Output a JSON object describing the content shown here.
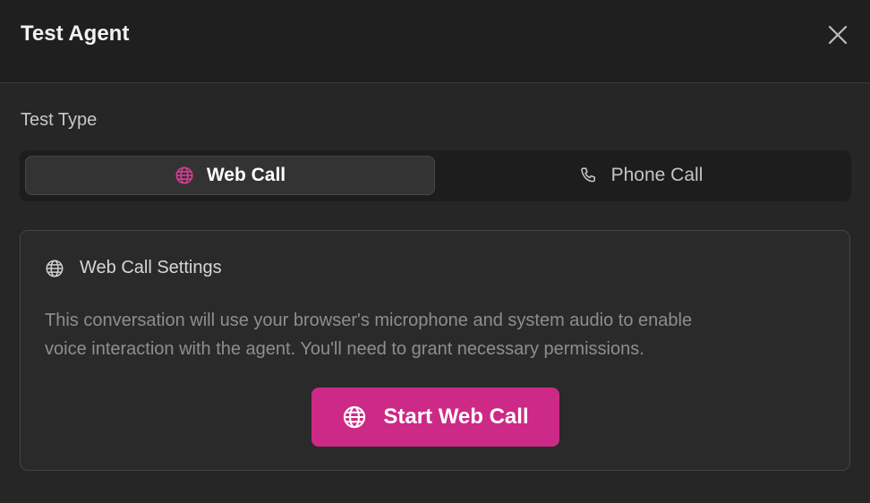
{
  "dialog": {
    "title": "Test Agent",
    "close_icon": "close-icon"
  },
  "test_type": {
    "label": "Test Type",
    "options": [
      {
        "label": "Web Call",
        "icon": "globe-icon",
        "selected": true
      },
      {
        "label": "Phone Call",
        "icon": "phone-icon",
        "selected": false
      }
    ]
  },
  "web_call_settings": {
    "title": "Web Call Settings",
    "icon": "globe-icon",
    "description_line1": "This conversation will use your browser's microphone and system audio to enable",
    "description_line2": "voice interaction with the agent. You'll need to grant necessary permissions.",
    "start_button_label": "Start Web Call",
    "start_button_icon": "globe-icon"
  },
  "colors": {
    "accent": "#cc2a86",
    "background": "#262626",
    "header_bg": "#1f1f1f"
  }
}
